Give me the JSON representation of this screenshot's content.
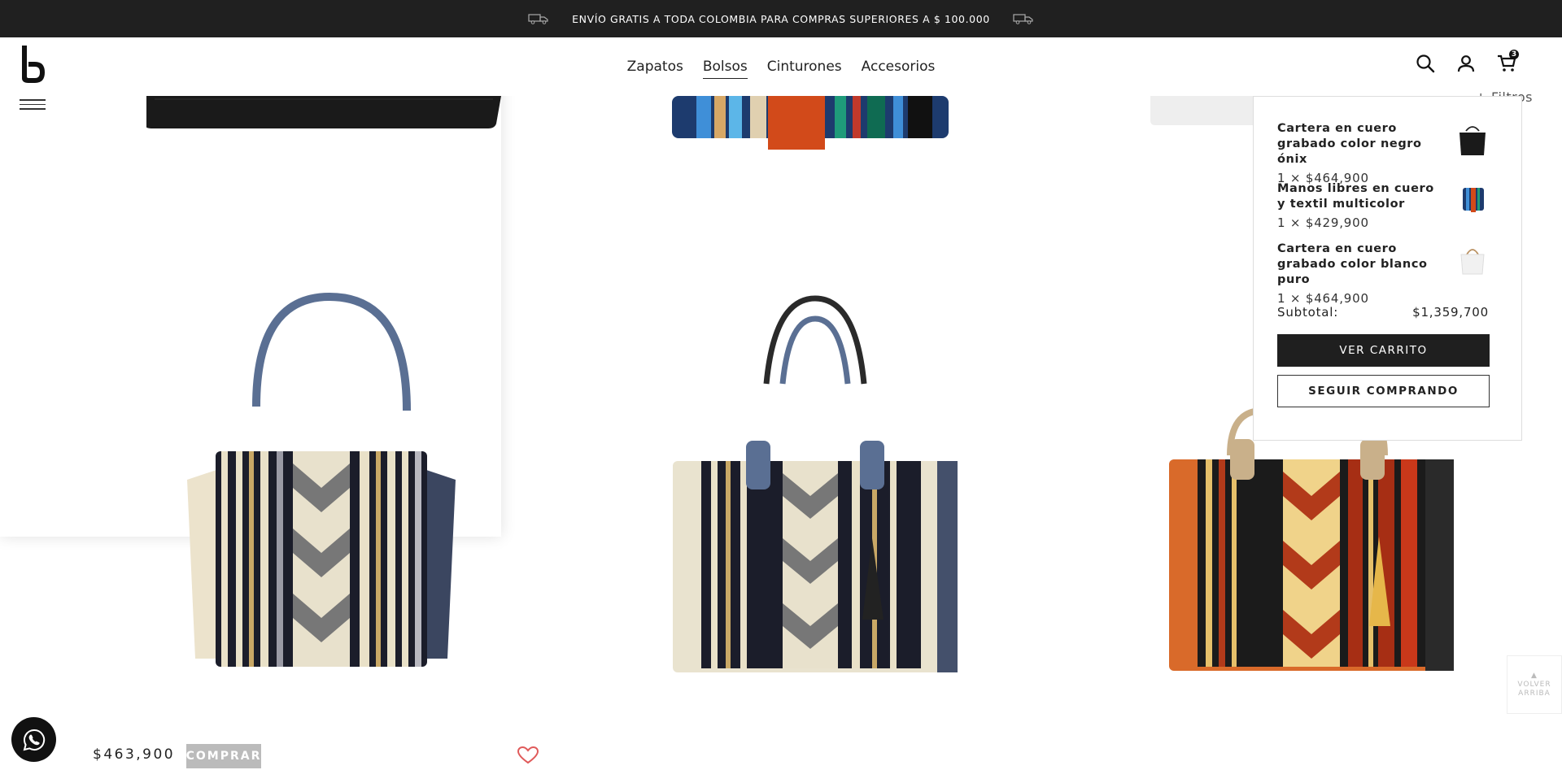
{
  "promo_banner": {
    "text": "ENVÍO GRATIS A TODA COLOMBIA PARA COMPRAS SUPERIORES A $ 100.000"
  },
  "nav": {
    "items": [
      "Zapatos",
      "Bolsos",
      "Cinturones",
      "Accesorios"
    ],
    "active": "Bolsos"
  },
  "header": {
    "cart_count": "3"
  },
  "filters_label": "+ Filtros",
  "product": {
    "price": "$463,900",
    "buy_label": "COMPRAR"
  },
  "minicart": {
    "items": [
      {
        "name": "Cartera en cuero grabado color negro ónix",
        "qty_price": "1 × $464,900"
      },
      {
        "name": "Manos libres en cuero y textil multicolor",
        "qty_price": "1 × $429,900"
      },
      {
        "name": "Cartera en cuero grabado color blanco puro",
        "qty_price": "1 × $464,900"
      }
    ],
    "subtotal_label": "Subtotal:",
    "subtotal_value": "$1,359,700",
    "view_cart_label": "VER CARRITO",
    "continue_label": "SEGUIR COMPRANDO"
  },
  "back_to_top": {
    "label_1": "VOLVER",
    "label_2": "ARRIBA"
  },
  "icons": [
    "truck-icon",
    "search-icon",
    "user-icon",
    "cart-icon",
    "heart-icon",
    "whatsapp-icon",
    "chevron-up-icon",
    "menu-icon"
  ],
  "colors": {
    "topbar": "#202020",
    "buy_button": "#bbbbbb",
    "heart": "#e05a5a",
    "dark_button": "#1f1f1f"
  }
}
